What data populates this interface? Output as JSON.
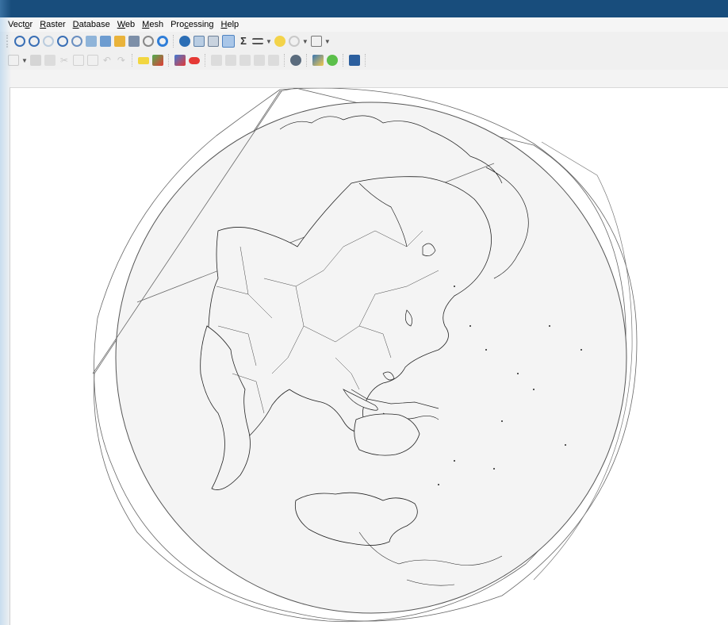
{
  "menubar": {
    "items": [
      {
        "label": "Vector",
        "accel": "o"
      },
      {
        "label": "Raster",
        "accel": "R"
      },
      {
        "label": "Database",
        "accel": "D"
      },
      {
        "label": "Web",
        "accel": "W"
      },
      {
        "label": "Mesh",
        "accel": "M"
      },
      {
        "label": "Processing",
        "accel": "c"
      },
      {
        "label": "Help",
        "accel": "H"
      }
    ]
  },
  "toolbar1": {
    "icons": [
      "zoom-in-icon",
      "zoom-out-icon",
      "zoom-native-icon",
      "zoom-full-icon",
      "zoom-selection-icon",
      "zoom-layer-icon",
      "zoom-last-icon",
      "zoom-next-icon",
      "new-bookmark-icon",
      "temporal-controller-icon",
      "refresh-icon",
      "identify-icon",
      "attribute-table-icon",
      "field-calculator-icon",
      "select-features-icon",
      "statistical-summary-icon",
      "measure-icon",
      "map-tips-icon",
      "settings-icon",
      "text-annotation-icon"
    ]
  },
  "toolbar2": {
    "icons": [
      "digitize-icon",
      "save-edits-icon",
      "delete-icon",
      "cut-icon",
      "copy-icon",
      "paste-icon",
      "undo-icon",
      "redo-icon",
      "label-icon",
      "pin-label-icon",
      "label-move-icon",
      "label-rotate-icon",
      "label-a-icon",
      "label-b-icon",
      "label-c-icon",
      "label-d-icon",
      "label-e-icon",
      "plugin-icon",
      "python-icon",
      "qgis-icon",
      "book-icon"
    ]
  },
  "colors": {
    "titlebar": "#184d7c",
    "globe_fill": "#f4f4f4",
    "outline": "#555555",
    "coast": "#222222"
  }
}
